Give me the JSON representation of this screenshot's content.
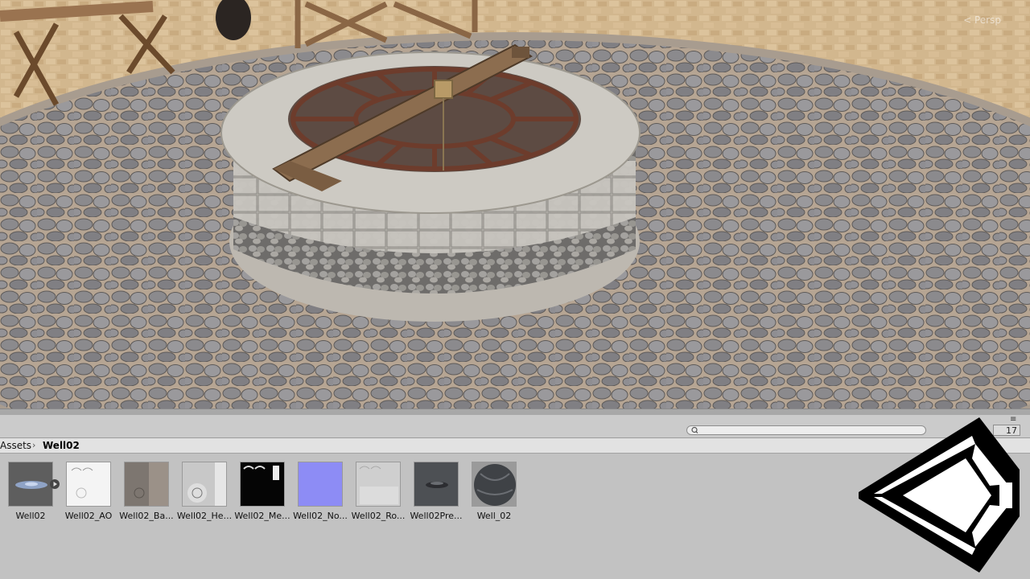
{
  "scene": {
    "perspective_label": "< Persp"
  },
  "project_panel": {
    "search_placeholder": "",
    "count_label": "17",
    "breadcrumb": {
      "root": "Assets",
      "separator": "›",
      "current": "Well02"
    },
    "assets": [
      {
        "label": "Well02",
        "thumb": "mesh-prefab",
        "color": "#5e5e5e"
      },
      {
        "label": "Well02_AO",
        "thumb": "ao-texture",
        "color": "#f4f4f4"
      },
      {
        "label": "Well02_Ba...",
        "thumb": "base-texture",
        "color": "#7d7670"
      },
      {
        "label": "Well02_He...",
        "thumb": "height-texture",
        "color": "#c8c8c8"
      },
      {
        "label": "Well02_Me...",
        "thumb": "metal-texture",
        "color": "#050505"
      },
      {
        "label": "Well02_No...",
        "thumb": "normal-texture",
        "color": "#8d8cf5"
      },
      {
        "label": "Well02_Ro...",
        "thumb": "rough-texture",
        "color": "#cfcfcf"
      },
      {
        "label": "Well02Pre...",
        "thumb": "prefab",
        "color": "#4d5054"
      },
      {
        "label": "Well_02",
        "thumb": "material-sphere",
        "color": "#3f4246"
      }
    ]
  },
  "colors": {
    "panel_bg": "#c2c2c2",
    "toolbar_bg": "#cbcbcb",
    "breadcrumb_bg": "#e2e2e2"
  }
}
